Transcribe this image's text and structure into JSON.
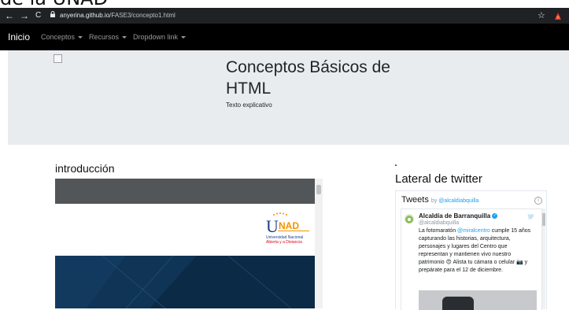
{
  "top_caption": "de la UNAD",
  "browser": {
    "back": "←",
    "forward": "→",
    "reload": "C",
    "url_host": "anyerina.github.io",
    "url_path": "/FASE3/concepto1.html",
    "lock_icon": "lock-icon",
    "star": "☆"
  },
  "navbar": {
    "brand": "Inicio",
    "items": [
      {
        "label": "Conceptos",
        "dropdown": true
      },
      {
        "label": "Recursos",
        "dropdown": true
      },
      {
        "label": "Dropdown link",
        "dropdown": true
      }
    ]
  },
  "jumbotron": {
    "title": "Conceptos Básicos de HTML",
    "subtitle": "Texto explicativo"
  },
  "main": {
    "section_title": "introducción"
  },
  "unad_logo": {
    "letters": "UNAD",
    "line1": "Universidad Nacional",
    "line2": "Abierta y a Distancia"
  },
  "sidebar": {
    "title": "Lateral de twitter",
    "widget": {
      "header": "Tweets",
      "by_prefix": "by",
      "by_handle": "@alcaldiabquilla",
      "info": "ⓘ"
    },
    "tweet": {
      "name": "Alcaldía de Barranquilla",
      "handle": "@alcaldiabquilla",
      "text_1": "La fotomaratón ",
      "mention": "@miralcentro",
      "text_2": " cumple 15 años capturando las historias, arquitectura, personajes y lugares del Centro que representan y mantienen vivo nuestro patrimonio 😍 Alista tu cámara o celular 📷 y prepárate para el 12 de diciembre."
    }
  },
  "colors": {
    "browser_chrome": "#202124",
    "navbar": "#000000",
    "jumbotron": "#e9ecef",
    "unad_orange": "#f39200",
    "unad_blue": "#1b3f8b",
    "twitter_blue": "#1da1f2"
  }
}
